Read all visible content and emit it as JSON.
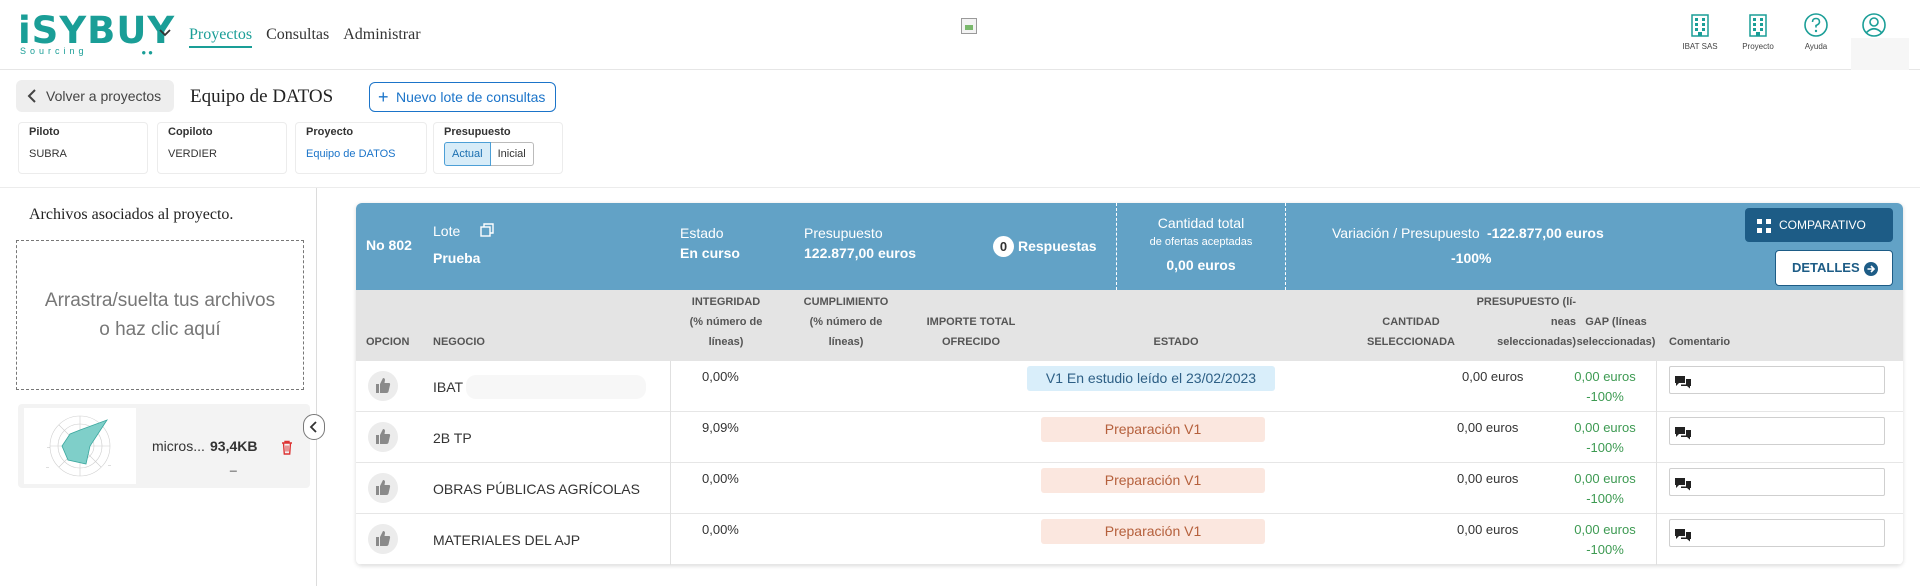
{
  "app": {
    "logo_main": "iSYBUY",
    "logo_sub": "Sourcing"
  },
  "nav": {
    "items": [
      "Proyectos",
      "Consultas",
      "Administrar"
    ]
  },
  "top_icons": [
    {
      "label": "IBAT SAS",
      "icon": "building-icon"
    },
    {
      "label": "Proyecto",
      "icon": "building-icon"
    },
    {
      "label": "Ayuda",
      "icon": "help-icon"
    }
  ],
  "header": {
    "back_label": "Volver a proyectos",
    "project_title": "Equipo de DATOS",
    "new_lot_label": "Nuevo lote de consultas"
  },
  "info": {
    "piloto_label": "Piloto",
    "piloto_value": "SUBRA",
    "copiloto_label": "Copiloto",
    "copiloto_value": "VERDIER",
    "proyecto_label": "Proyecto",
    "proyecto_value": "Equipo de DATOS",
    "presupuesto_label": "Presupuesto",
    "presupuesto_actual": "Actual",
    "presupuesto_inicial": "Inicial",
    "presupuesto_selected": "Actual"
  },
  "files": {
    "title": "Archivos asociados al proyecto.",
    "dropzone_line1": "Arrastra/suelta tus archivos",
    "dropzone_line2": "o haz clic aquí",
    "file_name": "micros...",
    "file_size": "93,4KB",
    "file_extra": "_"
  },
  "lot": {
    "number": "No 802",
    "lote_label": "Lote",
    "lote_value": "Prueba",
    "estado_label": "Estado",
    "estado_value": "En curso",
    "presupuesto_label": "Presupuesto",
    "presupuesto_value": "122.877,00 euros",
    "respuestas_count": "0",
    "respuestas_label": "Respuestas",
    "cantidad_label1": "Cantidad total",
    "cantidad_label2": "de ofertas aceptadas",
    "cantidad_value": "0,00 euros",
    "variacion_label": "Variación / Presupuesto",
    "variacion_value": "-122.877,00 euros",
    "variacion_pct": "-100%",
    "comparativo_label": "COMPARATIVO",
    "detalles_label": "DETALLES"
  },
  "table": {
    "headers": {
      "opcion": "OPCION",
      "negocio": "NEGOCIO",
      "integridad": [
        "INTEGRIDAD",
        "(% número de",
        "líneas)"
      ],
      "cumplimiento": [
        "CUMPLIMIENTO",
        "(% número de",
        "líneas)"
      ],
      "importe": [
        "IMPORTE TOTAL",
        "OFRECIDO"
      ],
      "estado": "ESTADO",
      "cantidad": [
        "CANTIDAD",
        "SELECCIONADA"
      ],
      "presupuesto": [
        "PRESUPUESTO (lí-",
        "neas",
        "seleccionadas)"
      ],
      "gap": [
        "GAP (líneas",
        "seleccionadas)"
      ],
      "comentario": "Comentario"
    },
    "rows": [
      {
        "negocio": "IBAT",
        "integridad": "0,00%",
        "estado": "V1 En estudio leído el 23/02/2023",
        "estado_style": "blue",
        "presupuesto": "0,00 euros",
        "gap_amount": "0,00 euros",
        "gap_pct": "-100%"
      },
      {
        "negocio": "2B TP",
        "integridad": "9,09%",
        "estado": "Preparación V1",
        "estado_style": "peach",
        "presupuesto": "0,00 euros",
        "gap_amount": "0,00 euros",
        "gap_pct": "-100%"
      },
      {
        "negocio": "OBRAS PÚBLICAS AGRÍCOLAS",
        "integridad": "0,00%",
        "estado": "Preparación V1",
        "estado_style": "peach",
        "presupuesto": "0,00 euros",
        "gap_amount": "0,00 euros",
        "gap_pct": "-100%"
      },
      {
        "negocio": "MATERIALES DEL AJP",
        "integridad": "0,00%",
        "estado": "Preparación V1",
        "estado_style": "peach",
        "presupuesto": "0,00 euros",
        "gap_amount": "0,00 euros",
        "gap_pct": "-100%"
      }
    ]
  },
  "colors": {
    "brand": "#1a9e97",
    "lot_header": "#62a2c6",
    "dark_button": "#1d5c86",
    "link": "#1b74c9",
    "gap_green": "#3d9a52"
  }
}
